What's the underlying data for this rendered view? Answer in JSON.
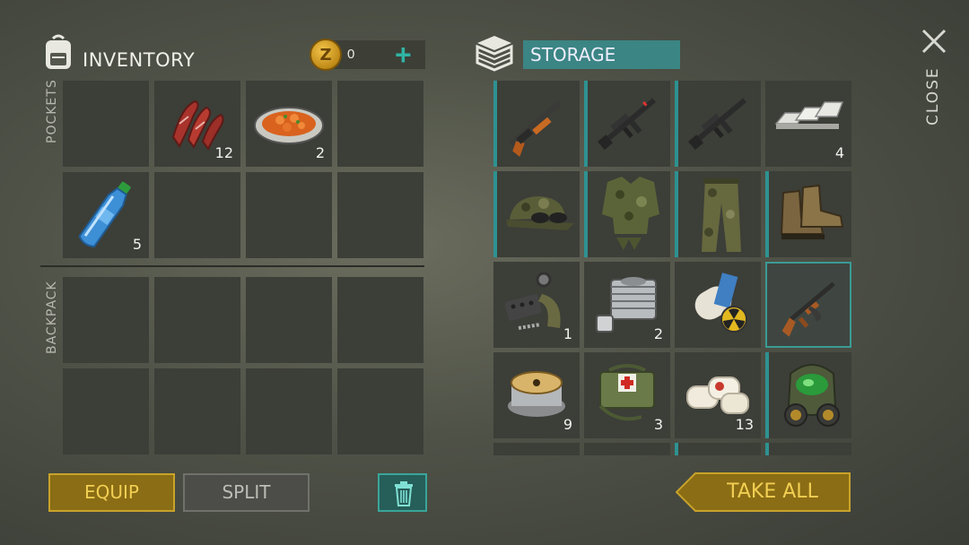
{
  "inventory": {
    "title": "INVENTORY",
    "coins": "0",
    "pockets_label": "POCKETS",
    "backpack_label": "BACKPACK",
    "pockets": [
      {
        "name": "empty-slot",
        "qty": ""
      },
      {
        "name": "raw-meat",
        "qty": "12"
      },
      {
        "name": "stew-plate",
        "qty": "2"
      },
      {
        "name": "empty-slot",
        "qty": ""
      },
      {
        "name": "water-bottle",
        "qty": "5"
      },
      {
        "name": "empty-slot",
        "qty": ""
      },
      {
        "name": "empty-slot",
        "qty": ""
      },
      {
        "name": "empty-slot",
        "qty": ""
      }
    ]
  },
  "storage": {
    "title": "STORAGE",
    "items": [
      {
        "name": "shotgun",
        "qty": ""
      },
      {
        "name": "m16-rifle-red-dot",
        "qty": ""
      },
      {
        "name": "m16-rifle",
        "qty": ""
      },
      {
        "name": "iron-bars",
        "qty": "4"
      },
      {
        "name": "camo-cap",
        "qty": ""
      },
      {
        "name": "camo-vest",
        "qty": ""
      },
      {
        "name": "camo-pants",
        "qty": ""
      },
      {
        "name": "military-boots",
        "qty": ""
      },
      {
        "name": "weapon-parts",
        "qty": "1"
      },
      {
        "name": "engine-cylinder",
        "qty": "2"
      },
      {
        "name": "radio-magazines",
        "qty": ""
      },
      {
        "name": "ak-rifle",
        "qty": ""
      },
      {
        "name": "wire-spool",
        "qty": "9"
      },
      {
        "name": "medical-bag",
        "qty": "3"
      },
      {
        "name": "bandages",
        "qty": "13"
      },
      {
        "name": "gas-mask",
        "qty": ""
      }
    ]
  },
  "buttons": {
    "equip": "EQUIP",
    "split": "SPLIT",
    "take_all": "TAKE ALL",
    "close": "CLOSE"
  },
  "colors": {
    "accent": "#2e9291",
    "gold": "#f2cf53",
    "cell": "#3c3e38"
  }
}
